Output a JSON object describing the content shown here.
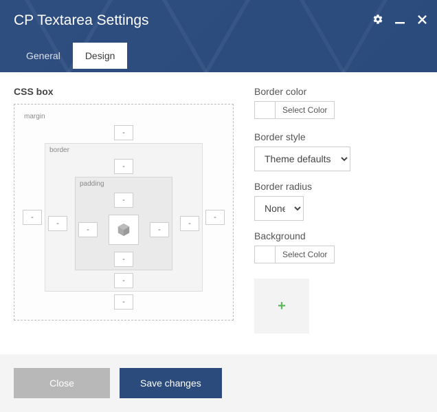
{
  "header": {
    "title": "CP Textarea Settings"
  },
  "tabs": {
    "general": "General",
    "design": "Design"
  },
  "cssbox": {
    "title": "CSS box",
    "labels": {
      "margin": "margin",
      "border": "border",
      "padding": "padding"
    },
    "margin": {
      "top": "-",
      "right": "-",
      "bottom": "-",
      "left": "-"
    },
    "border": {
      "top": "-",
      "right": "-",
      "bottom": "-",
      "left": "-"
    },
    "padding": {
      "top": "-",
      "right": "-",
      "bottom": "-",
      "left": "-"
    }
  },
  "sidebar": {
    "border_color": {
      "label": "Border color",
      "button": "Select Color"
    },
    "border_style": {
      "label": "Border style",
      "value": "Theme defaults"
    },
    "border_radius": {
      "label": "Border radius",
      "value": "None"
    },
    "background": {
      "label": "Background",
      "button": "Select Color"
    }
  },
  "footer": {
    "close": "Close",
    "save": "Save changes"
  },
  "icons": {
    "gear": "gear-icon",
    "minimize": "minimize-icon",
    "close": "close-icon",
    "content": "cube-icon",
    "add": "+"
  }
}
